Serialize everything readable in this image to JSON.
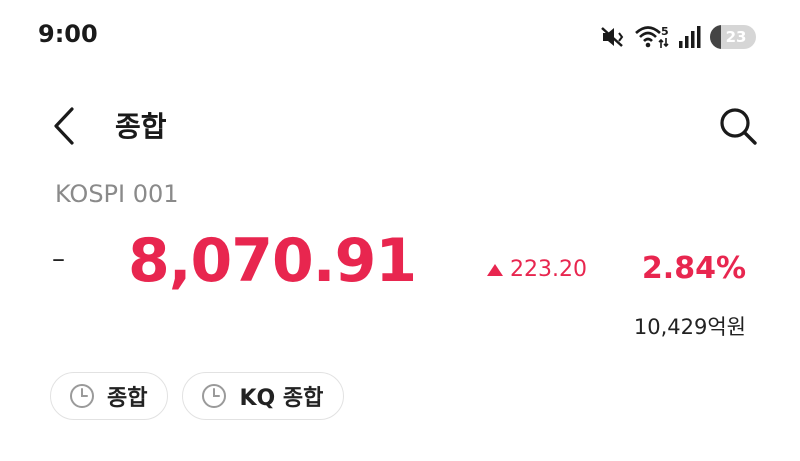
{
  "status_bar": {
    "time": "9:00",
    "network_badge": "5",
    "battery_level": "23",
    "icons": [
      "mute-vibrate-icon",
      "wifi-icon",
      "signal-icon",
      "battery-icon"
    ]
  },
  "header": {
    "back_icon": "chevron-left-icon",
    "title": "종합",
    "search_icon": "search-icon"
  },
  "index": {
    "code_label": "KOSPI 001",
    "dash": "–",
    "value": "8,070.91",
    "change_arrow_icon": "triangle-up-icon",
    "change": "223.20",
    "change_percent": "2.84%",
    "trading_value": "10,429억원"
  },
  "chips": [
    {
      "icon": "clock-icon",
      "label": "종합"
    },
    {
      "icon": "clock-icon",
      "label": "KQ 종합"
    }
  ],
  "colors": {
    "up_red": "#e8264f",
    "muted_gray": "#8a8a8a",
    "chip_border": "#e2e2e2"
  }
}
